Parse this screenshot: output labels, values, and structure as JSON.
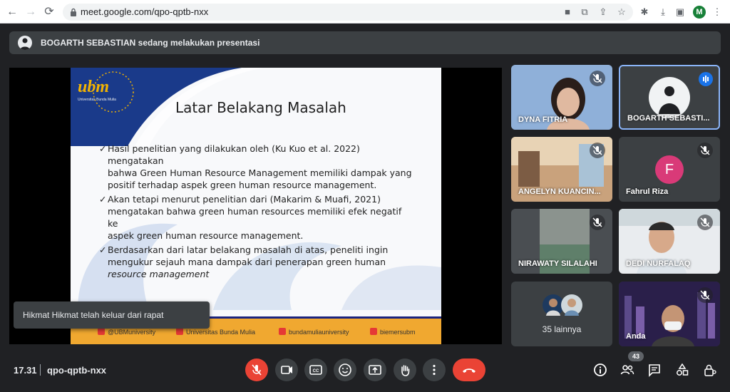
{
  "browser": {
    "url": "meet.google.com/qpo-qptb-nxx",
    "profile_initial": "M"
  },
  "banner": {
    "text": "BOGARTH SEBASTIAN sedang melakukan presentasi"
  },
  "slide": {
    "logo_text": "ubm",
    "logo_sub": "Universitas Bunda Mulia",
    "title": "Latar Belakang Masalah",
    "bullets": [
      {
        "check": "✓",
        "lines": [
          "Hasil penelitian yang dilakukan oleh (Ku Kuo et al. 2022) mengatakan",
          "bahwa Green Human Resource Management memiliki dampak yang",
          "positif terhadap aspek green human resource management."
        ]
      },
      {
        "check": "✓",
        "lines": [
          "Akan tetapi menurut penelitian dari (Makarim & Muafi, 2021)",
          "mengatakan bahwa green human resources memiliki efek negatif ke",
          "aspek green human resource management."
        ]
      },
      {
        "check": "✓",
        "lines": [
          "Berdasarkan dari latar belakang masalah di atas, peneliti ingin",
          "mengukur sejauh mana dampak dari penerapan green human",
          "resource management"
        ]
      }
    ],
    "footer": {
      "twitter": "@UBMuniversity",
      "facebook": "Universitas Bunda Mulia",
      "instagram": "bundamuliauniversity",
      "youtube": "biemersubm"
    }
  },
  "toast": {
    "text": "Hikmat Hikmat telah keluar dari rapat"
  },
  "participants": [
    {
      "name": "DYNA FITRIA"
    },
    {
      "name": "BOGARTH SEBASTI..."
    },
    {
      "name": "ANGELYN KUANCIN..."
    },
    {
      "name": "Fahrul Riza",
      "initial": "F"
    },
    {
      "name": "NIRAWATY SILALAHI"
    },
    {
      "name": "DEDI NURFALAQ"
    },
    {
      "name": "35 lainnya"
    },
    {
      "name": "Anda"
    }
  ],
  "toolbar": {
    "time": "17.31",
    "meeting_code": "qpo-qptb-nxx",
    "participant_count": "43"
  },
  "colors": {
    "accent": "#8ab4f8",
    "danger": "#ea4335",
    "surface": "#3c4043",
    "background": "#202124"
  }
}
